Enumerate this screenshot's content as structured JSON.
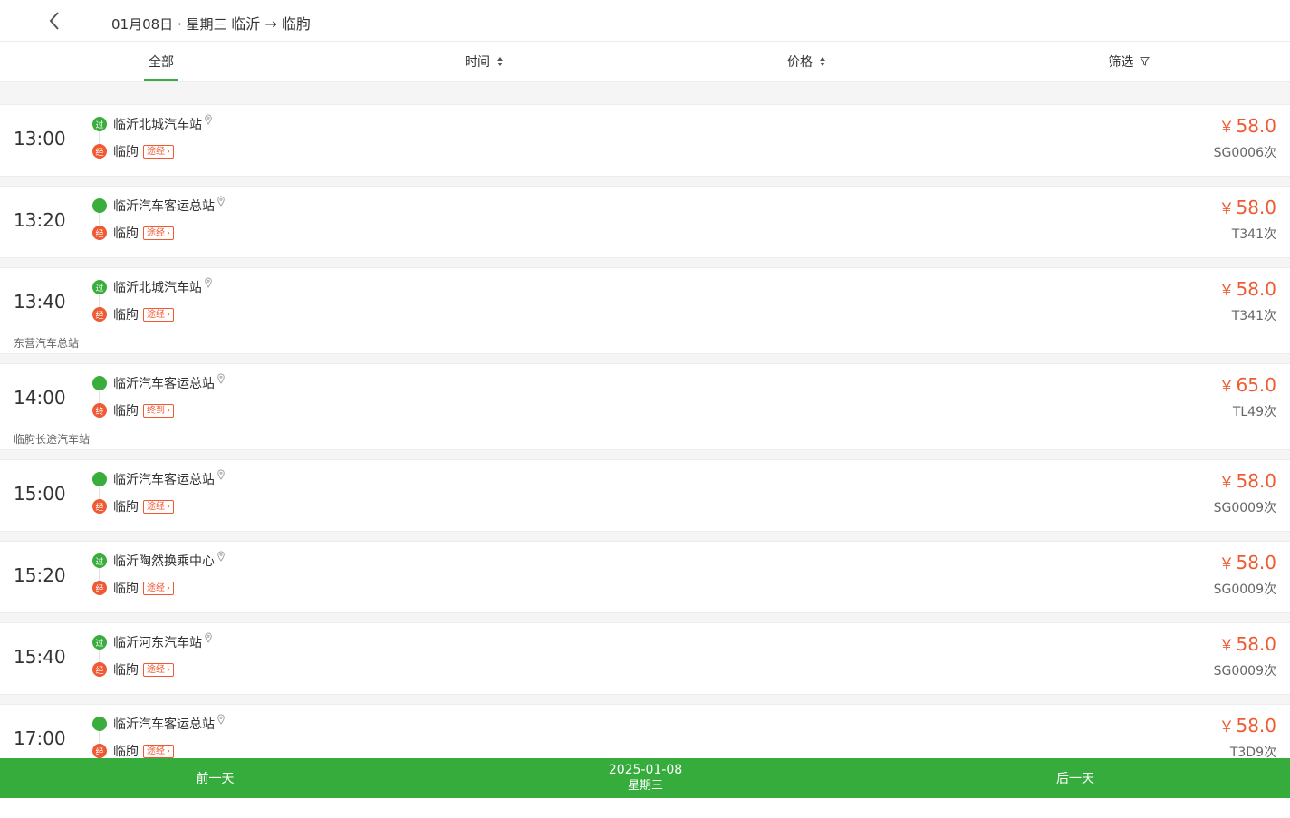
{
  "header": {
    "date_label": "01月08日 · 星期三",
    "route": "临沂 → 临朐"
  },
  "tabs": [
    {
      "label": "全部"
    },
    {
      "label": "时间"
    },
    {
      "label": "价格"
    },
    {
      "label": "筛选"
    }
  ],
  "trips": [
    {
      "time": "13:00",
      "from": "临沂北城汽车站",
      "from_badge": "过",
      "to": "临朐",
      "to_badge": "经",
      "tag": "途经",
      "price": "58.0",
      "code": "SG0006次",
      "note": ""
    },
    {
      "time": "13:20",
      "from": "临沂汽车客运总站",
      "from_badge": "",
      "to": "临朐",
      "to_badge": "经",
      "tag": "途经",
      "price": "58.0",
      "code": "T341次",
      "note": ""
    },
    {
      "time": "13:40",
      "from": "临沂北城汽车站",
      "from_badge": "过",
      "to": "临朐",
      "to_badge": "经",
      "tag": "途经",
      "price": "58.0",
      "code": "T341次",
      "note": "东营汽车总站"
    },
    {
      "time": "14:00",
      "from": "临沂汽车客运总站",
      "from_badge": "",
      "to": "临朐",
      "to_badge": "终",
      "tag": "终到",
      "price": "65.0",
      "code": "TL49次",
      "note": "临朐长途汽车站"
    },
    {
      "time": "15:00",
      "from": "临沂汽车客运总站",
      "from_badge": "",
      "to": "临朐",
      "to_badge": "经",
      "tag": "途经",
      "price": "58.0",
      "code": "SG0009次",
      "note": ""
    },
    {
      "time": "15:20",
      "from": "临沂陶然换乘中心",
      "from_badge": "过",
      "to": "临朐",
      "to_badge": "经",
      "tag": "途经",
      "price": "58.0",
      "code": "SG0009次",
      "note": ""
    },
    {
      "time": "15:40",
      "from": "临沂河东汽车站",
      "from_badge": "过",
      "to": "临朐",
      "to_badge": "经",
      "tag": "途经",
      "price": "58.0",
      "code": "SG0009次",
      "note": ""
    },
    {
      "time": "17:00",
      "from": "临沂汽车客运总站",
      "from_badge": "",
      "to": "临朐",
      "to_badge": "经",
      "tag": "途经",
      "price": "58.0",
      "code": "T3D9次",
      "note": ""
    }
  ],
  "currency": "￥",
  "footer": {
    "prev_label": "前一天",
    "date": "2025-01-08",
    "weekday": "星期三",
    "next_label": "后一天"
  },
  "colors": {
    "accent": "#3aad3c",
    "price": "#f05a33",
    "footer_bg": "#36ac3d"
  }
}
